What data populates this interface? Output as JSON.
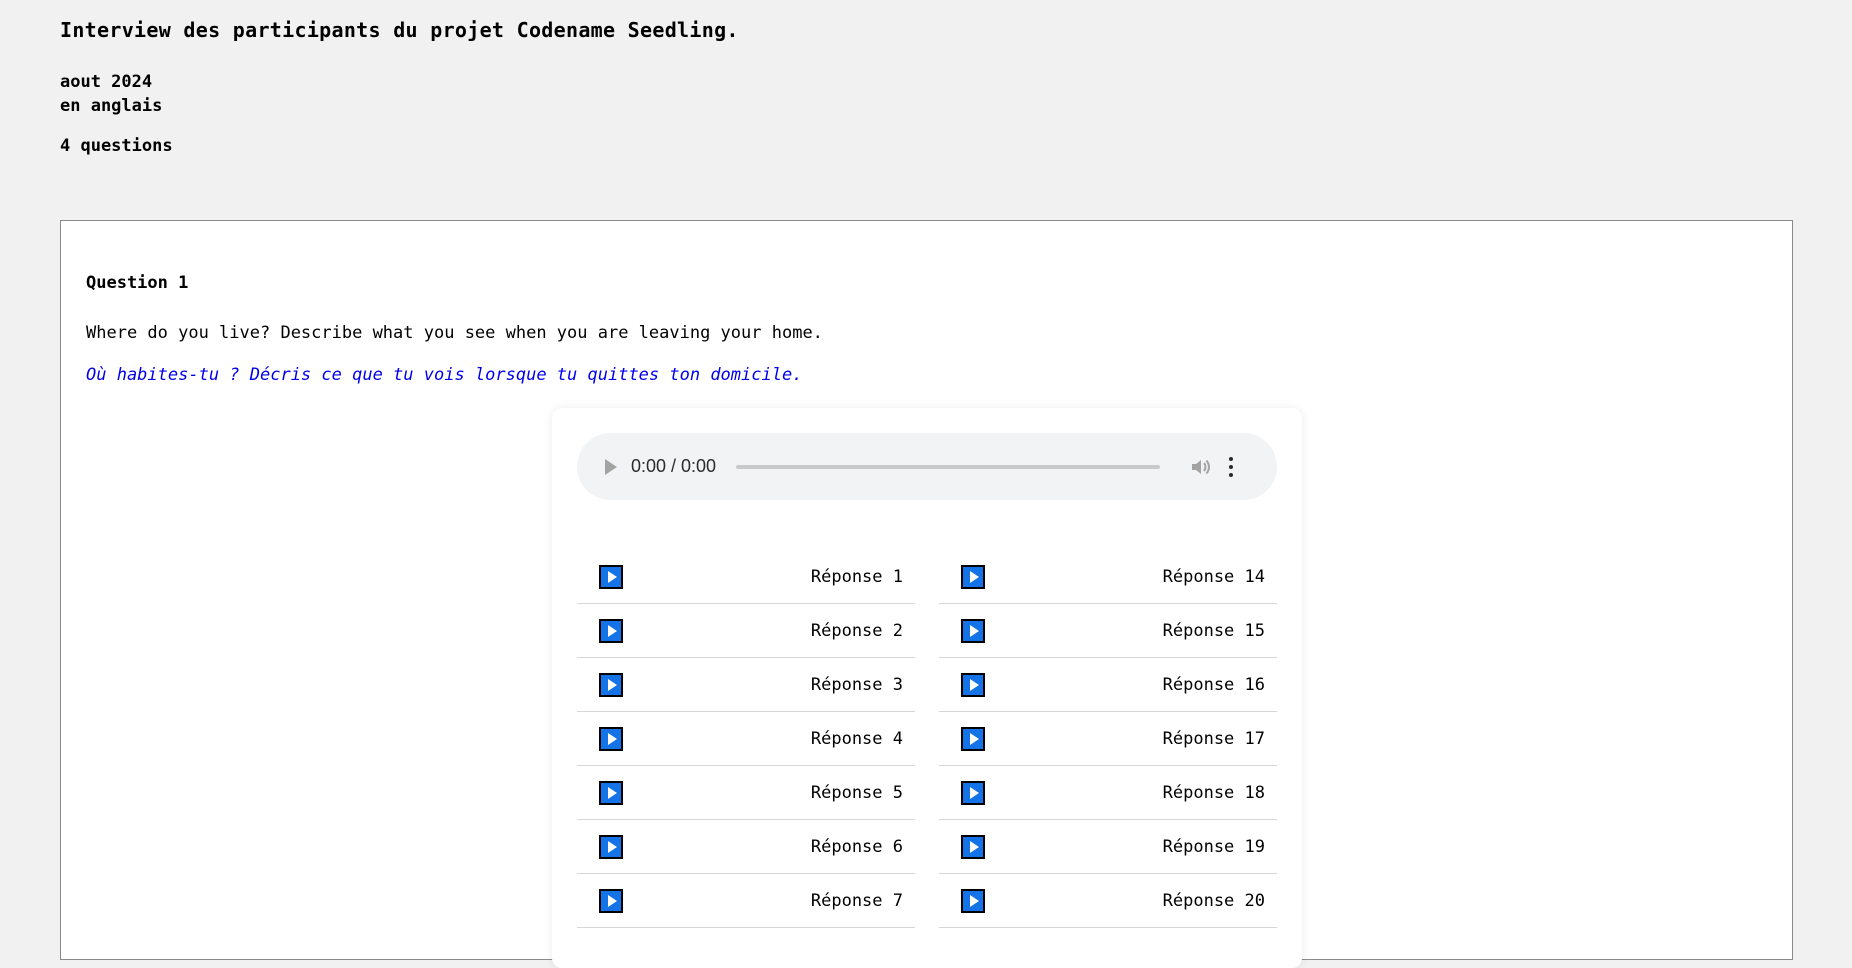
{
  "header": {
    "title": "Interview des participants du projet Codename Seedling.",
    "date": "aout 2024",
    "language": "en anglais",
    "question_count": "4 questions"
  },
  "question": {
    "label": "Question 1",
    "text_en": "Where do you live? Describe what you see when you are leaving your home.",
    "text_fr": "Où habites-tu ? Décris ce que tu vois lorsque tu quittes ton domicile."
  },
  "player": {
    "time": "0:00 / 0:00"
  },
  "responses_left": [
    {
      "label": "Réponse 1"
    },
    {
      "label": "Réponse 2"
    },
    {
      "label": "Réponse 3"
    },
    {
      "label": "Réponse 4"
    },
    {
      "label": "Réponse 5"
    },
    {
      "label": "Réponse 6"
    },
    {
      "label": "Réponse 7"
    }
  ],
  "responses_right": [
    {
      "label": "Réponse 14"
    },
    {
      "label": "Réponse 15"
    },
    {
      "label": "Réponse 16"
    },
    {
      "label": "Réponse 17"
    },
    {
      "label": "Réponse 18"
    },
    {
      "label": "Réponse 19"
    },
    {
      "label": "Réponse 20"
    }
  ],
  "colors": {
    "accent": "#1473e6",
    "translation_text": "#0000ee"
  },
  "icons": {
    "response_play": "play-icon",
    "player_play": "play-icon",
    "volume": "volume-icon",
    "more": "more-vertical-icon"
  }
}
